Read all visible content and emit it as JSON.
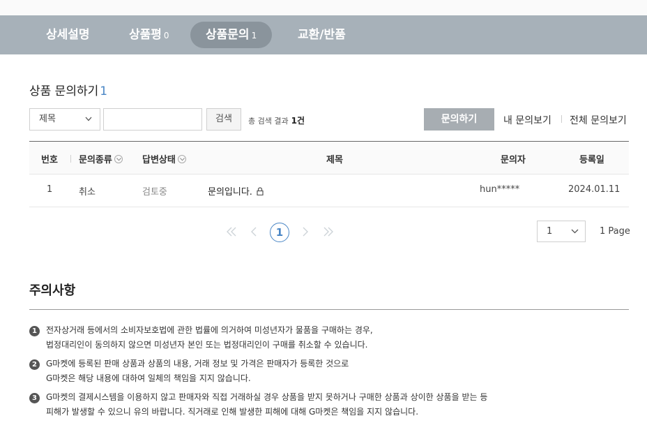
{
  "tabs": [
    {
      "label": "상세설명",
      "count": ""
    },
    {
      "label": "상품평",
      "count": "0"
    },
    {
      "label": "상품문의",
      "count": "1"
    },
    {
      "label": "교환/반품",
      "count": ""
    }
  ],
  "section": {
    "title": "상품 문의하기",
    "count": "1"
  },
  "search": {
    "select_value": "제목",
    "input_value": "",
    "button_label": "검색",
    "result_prefix": "총 검색 결과",
    "result_count": "1건"
  },
  "actions": {
    "ask_label": "문의하기",
    "my_label": "내 문의보기",
    "all_label": "전체 문의보기"
  },
  "table": {
    "headers": {
      "no": "번호",
      "type": "문의종류",
      "status": "답변상태",
      "title": "제목",
      "author": "문의자",
      "date": "등록일"
    },
    "rows": [
      {
        "no": "1",
        "type": "취소",
        "status": "검토중",
        "title": "문의입니다.",
        "author": "hun*****",
        "date": "2024.01.11"
      }
    ]
  },
  "pagination": {
    "current": "1",
    "select_value": "1",
    "total_label": "1 Page"
  },
  "notice": {
    "title": "주의사항",
    "items": [
      {
        "num": "1",
        "line1": "전자상거래 등에서의 소비자보호법에 관한 법률에 의거하여 미성년자가 물품을 구매하는 경우,",
        "line2": "법정대리인이 동의하지 않으면 미성년자 본인 또는 법정대리인이 구매를 취소할 수 있습니다."
      },
      {
        "num": "2",
        "line1": "G마켓에 등록된 판매 상품과 상품의 내용, 거래 정보 및 가격은 판매자가 등록한 것으로",
        "line2": "G마켓은 해당 내용에 대하여 일체의 책임을 지지 않습니다."
      },
      {
        "num": "3",
        "line1": "G마켓의 결제시스템을 이용하지 않고 판매자와 직접 거래하실 경우 상품을 받지 못하거나 구매한 상품과 상이한 상품을 받는 등",
        "line2": "피해가 발생할 수 있으니 유의 바랍니다. 직거래로 인해 발생한 피해에 대해 G마켓은 책임을 지지 않습니다."
      }
    ]
  },
  "colors": {
    "tab_bar": "#a7b1b9",
    "tab_active": "#8a949c",
    "accent": "#4a86c5",
    "ask_button": "#a7adb2"
  }
}
